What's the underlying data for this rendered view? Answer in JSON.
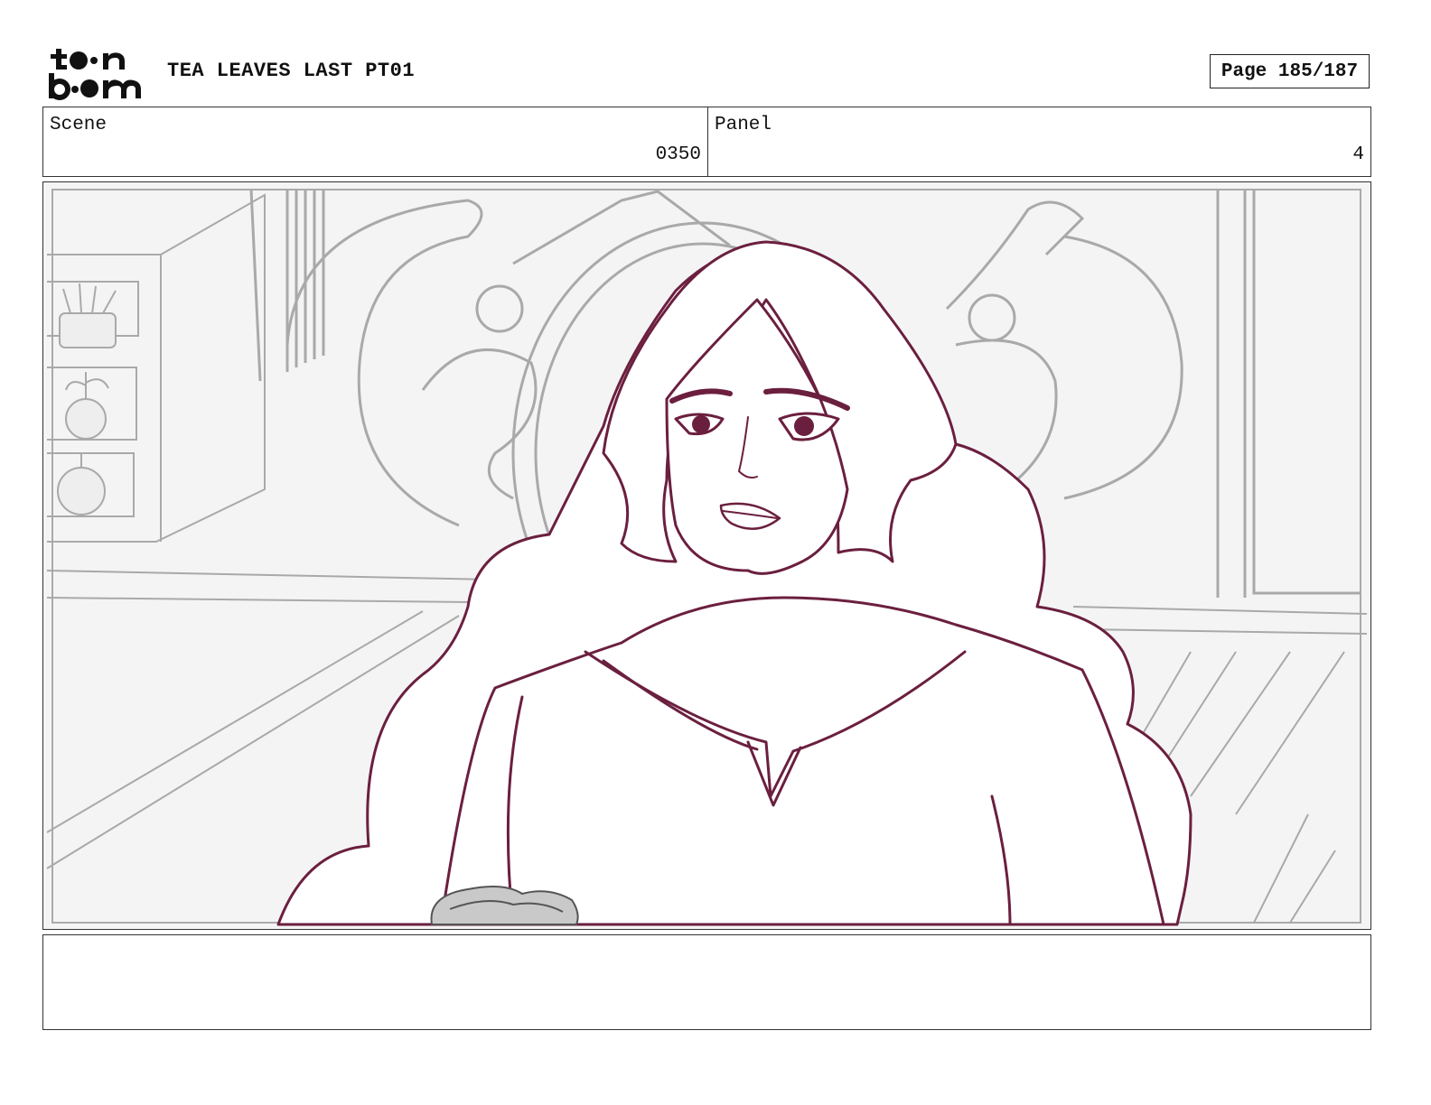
{
  "header": {
    "logo_text": "toon boom",
    "title": "TEA LEAVES LAST PT01",
    "page_label": "Page 185/187"
  },
  "scene": {
    "label": "Scene",
    "value": "0350"
  },
  "panel": {
    "label": "Panel",
    "value": "4"
  },
  "colors": {
    "line_art": "#6b1f3f",
    "background_lines": "#a9a9a9",
    "border": "#333333"
  },
  "notes": {
    "text": ""
  }
}
